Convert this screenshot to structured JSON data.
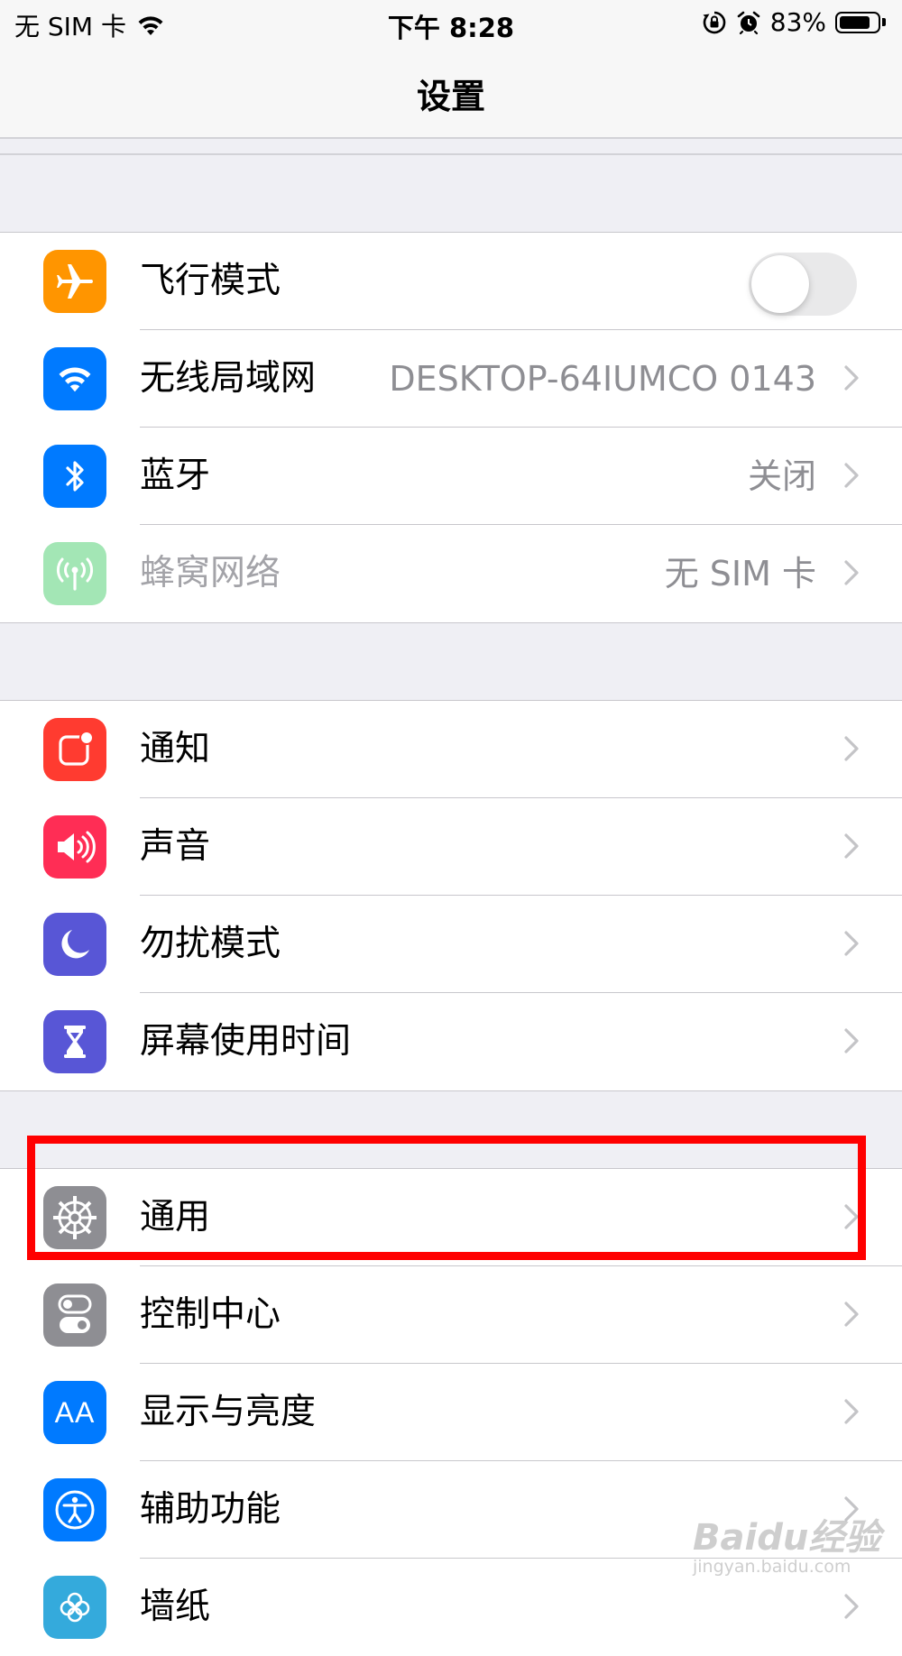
{
  "status_bar": {
    "carrier": "无 SIM 卡",
    "time": "下午 8:28",
    "battery": "83%",
    "battery_level": 0.83
  },
  "nav": {
    "title": "设置"
  },
  "groups": [
    {
      "rows": [
        {
          "label": "飞行模式",
          "icon": "airplane-icon",
          "icon_color": "#ff9500",
          "toggle": false
        },
        {
          "label": "无线局域网",
          "icon": "wifi-icon",
          "icon_color": "#007aff",
          "value": "DESKTOP-64IUMCO 0143"
        },
        {
          "label": "蓝牙",
          "icon": "bluetooth-icon",
          "icon_color": "#007aff",
          "value": "关闭"
        },
        {
          "label": "蜂窝网络",
          "icon": "cellular-icon",
          "icon_color": "#a3e6b5",
          "value": "无 SIM 卡",
          "disabled": true
        }
      ]
    },
    {
      "rows": [
        {
          "label": "通知",
          "icon": "notifications-icon",
          "icon_color": "#ff3b30"
        },
        {
          "label": "声音",
          "icon": "sound-icon",
          "icon_color": "#ff2d55"
        },
        {
          "label": "勿扰模式",
          "icon": "moon-icon",
          "icon_color": "#5856d6"
        },
        {
          "label": "屏幕使用时间",
          "icon": "hourglass-icon",
          "icon_color": "#5856d6"
        }
      ]
    },
    {
      "rows": [
        {
          "label": "通用",
          "icon": "gear-icon",
          "icon_color": "#8e8e93"
        },
        {
          "label": "控制中心",
          "icon": "switches-icon",
          "icon_color": "#8e8e93"
        },
        {
          "label": "显示与亮度",
          "icon": "text-size-icon",
          "icon_color": "#007aff",
          "icon_text": "AA"
        },
        {
          "label": "辅助功能",
          "icon": "accessibility-icon",
          "icon_color": "#007aff"
        },
        {
          "label": "墙纸",
          "icon": "wallpaper-icon",
          "icon_color": "#34aadc"
        }
      ]
    }
  ],
  "highlight_color": "#ff0000",
  "watermark": {
    "main": "Baidu经验",
    "sub": "jingyan.baidu.com"
  }
}
